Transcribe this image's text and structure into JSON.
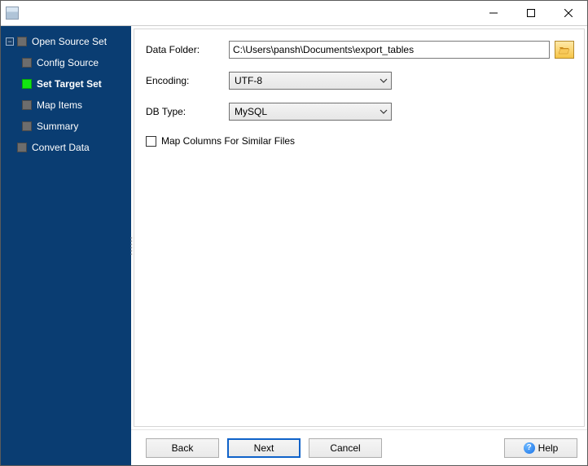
{
  "window": {
    "title": ""
  },
  "sidebar": {
    "items": [
      {
        "label": "Open Source Set",
        "expandable": true,
        "active": false,
        "children": [
          {
            "label": "Config Source",
            "active": false
          },
          {
            "label": "Set Target Set",
            "active": true
          },
          {
            "label": "Map Items",
            "active": false
          },
          {
            "label": "Summary",
            "active": false
          }
        ]
      },
      {
        "label": "Convert Data",
        "expandable": false,
        "active": false,
        "children": []
      }
    ]
  },
  "form": {
    "data_folder": {
      "label": "Data Folder:",
      "value": "C:\\Users\\pansh\\Documents\\export_tables"
    },
    "encoding": {
      "label": "Encoding:",
      "value": "UTF-8"
    },
    "db_type": {
      "label": "DB Type:",
      "value": "MySQL"
    },
    "map_columns": {
      "label": "Map Columns For Similar Files",
      "checked": false
    }
  },
  "buttons": {
    "back": "Back",
    "next": "Next",
    "cancel": "Cancel",
    "help": "Help"
  }
}
